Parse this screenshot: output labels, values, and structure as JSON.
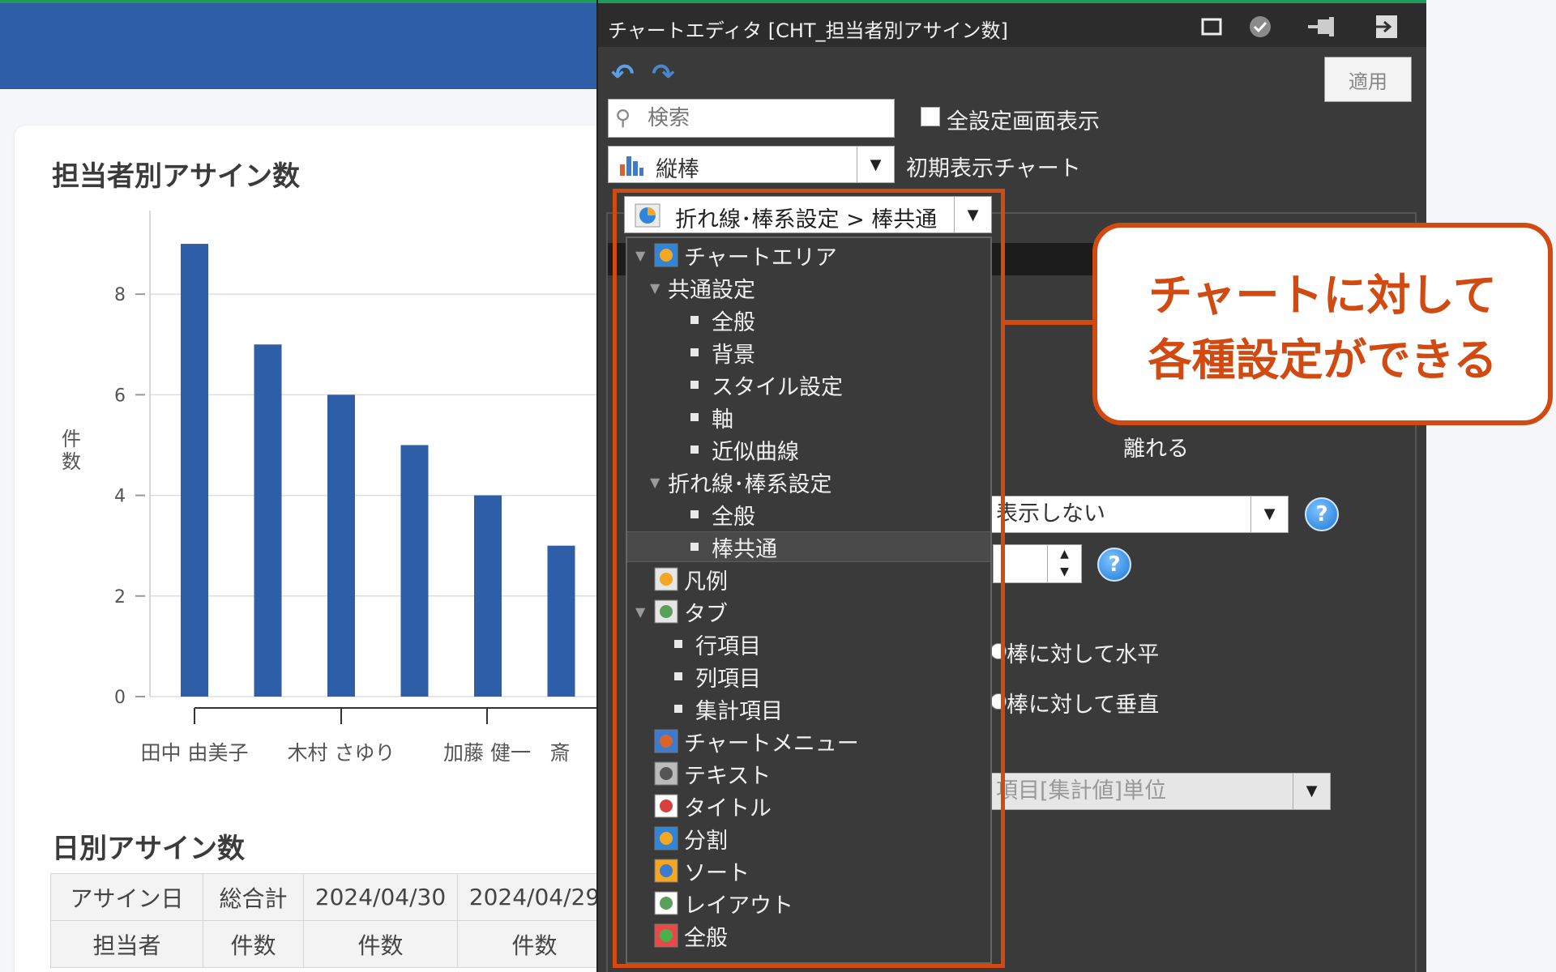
{
  "dashboard": {
    "chart_title": "担当者別アサイン数",
    "table_title": "日別アサイン数",
    "table": {
      "row1": [
        "アサイン日",
        "総合計",
        "2024/04/30",
        "2024/04/29"
      ],
      "row2": [
        "担当者",
        "件数",
        "件数",
        "件数"
      ]
    }
  },
  "chart_data": {
    "type": "bar",
    "title": "担当者別アサイン数",
    "ylabel": "件数",
    "xlabel": "",
    "categories": [
      "田中 由美子",
      "",
      "木村 さゆり",
      "",
      "加藤 健一",
      "斎"
    ],
    "values": [
      9,
      7,
      6,
      5,
      4,
      3
    ],
    "ylim": [
      0,
      9.5
    ],
    "yticks": [
      0,
      2,
      4,
      6,
      8
    ],
    "grid": true,
    "color": "#2e5ea8"
  },
  "editor": {
    "title": "チャートエディタ [CHT_担当者別アサイン数]",
    "apply_label": "適用",
    "search_placeholder": "検索",
    "show_all_label": "全設定画面表示",
    "chart_type": "縦棒",
    "initial_chart_label": "初期表示チャート",
    "breadcrumb": "折れ線･棒系設定 > 棒共通",
    "underlying": {
      "leave_label": "離れる",
      "select_value": "表示しない",
      "radio1": "棒に対して水平",
      "radio2": "棒に対して垂直",
      "unit_select": "項目[集計値]単位"
    },
    "tree": [
      {
        "label": "チャートエリア",
        "level": 0,
        "expand": "▼",
        "icon": "pie-icon"
      },
      {
        "label": "共通設定",
        "level": 1,
        "expand": "▼"
      },
      {
        "label": "全般",
        "level": 2
      },
      {
        "label": "背景",
        "level": 2
      },
      {
        "label": "スタイル設定",
        "level": 2
      },
      {
        "label": "軸",
        "level": 2
      },
      {
        "label": "近似曲線",
        "level": 2
      },
      {
        "label": "折れ線･棒系設定",
        "level": 1,
        "expand": "▼"
      },
      {
        "label": "全般",
        "level": 2
      },
      {
        "label": "棒共通",
        "level": 2,
        "selected": true
      },
      {
        "label": "凡例",
        "level": 0,
        "icon": "legend-icon"
      },
      {
        "label": "タブ",
        "level": 0,
        "expand": "▼",
        "icon": "tab-icon"
      },
      {
        "label": "行項目",
        "level": 3
      },
      {
        "label": "列項目",
        "level": 3
      },
      {
        "label": "集計項目",
        "level": 3
      },
      {
        "label": "チャートメニュー",
        "level": 0,
        "icon": "chart-menu-icon"
      },
      {
        "label": "テキスト",
        "level": 0,
        "icon": "text-icon"
      },
      {
        "label": "タイトル",
        "level": 0,
        "icon": "title-icon"
      },
      {
        "label": "分割",
        "level": 0,
        "icon": "split-icon"
      },
      {
        "label": "ソート",
        "level": 0,
        "icon": "sort-icon"
      },
      {
        "label": "レイアウト",
        "level": 0,
        "icon": "layout-icon"
      },
      {
        "label": "全般",
        "level": 0,
        "icon": "general-icon"
      }
    ]
  },
  "callout": {
    "line1": "チャートに対して",
    "line2": "各種設定ができる"
  }
}
